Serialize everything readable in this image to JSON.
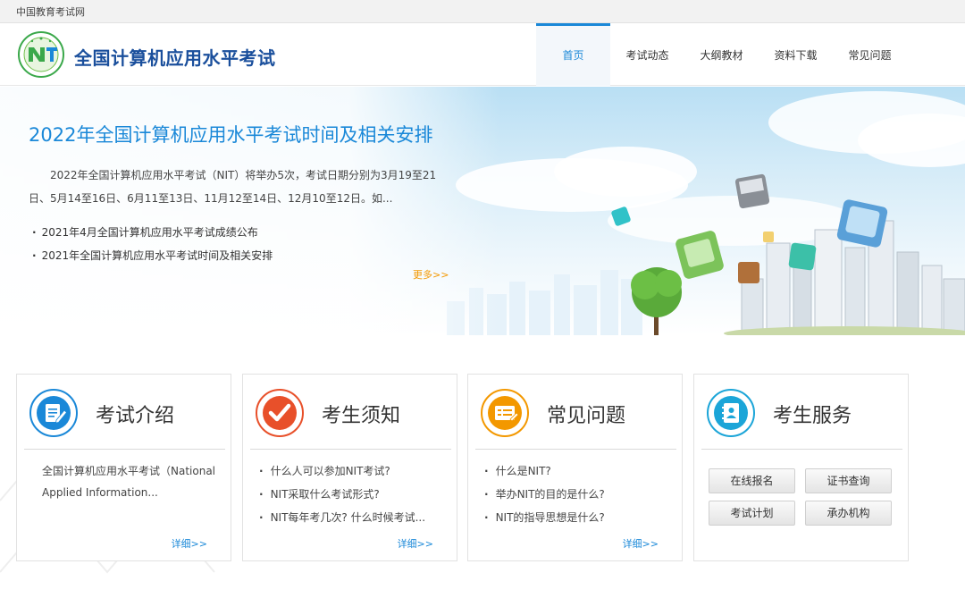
{
  "topbar": {
    "site_name": "中国教育考试网"
  },
  "header": {
    "brand": "全国计算机应用水平考试",
    "nav": [
      {
        "label": "首页",
        "active": true
      },
      {
        "label": "考试动态",
        "active": false
      },
      {
        "label": "大纲教材",
        "active": false
      },
      {
        "label": "资料下载",
        "active": false
      },
      {
        "label": "常见问题",
        "active": false
      }
    ]
  },
  "banner": {
    "title": "2022年全国计算机应用水平考试时间及相关安排",
    "description": "2022年全国计算机应用水平考试（NIT）将举办5次，考试日期分别为3月19至21日、5月14至16日、6月11至13日、11月12至14日、12月10至12日。如...",
    "news": [
      "2021年4月全国计算机应用水平考试成绩公布",
      "2021年全国计算机应用水平考试时间及相关安排"
    ],
    "more": "更多>>"
  },
  "cards": [
    {
      "title": "考试介绍",
      "icon": "document-edit-icon",
      "color": "#1a88d8",
      "intro": "全国计算机应用水平考试（National Applied Information...",
      "detail": "详细>>"
    },
    {
      "title": "考生须知",
      "icon": "checkmark-icon",
      "color": "#e8502a",
      "items": [
        "什么人可以参加NIT考试?",
        "NIT采取什么考试形式?",
        "NIT每年考几次? 什么时候考试..."
      ],
      "detail": "详细>>"
    },
    {
      "title": "常见问题",
      "icon": "list-form-icon",
      "color": "#f39800",
      "items": [
        "什么是NIT?",
        "举办NIT的目的是什么?",
        "NIT的指导思想是什么?"
      ],
      "detail": "详细>>"
    },
    {
      "title": "考生服务",
      "icon": "contacts-book-icon",
      "color": "#1ba5d8",
      "buttons": [
        "在线报名",
        "证书查询",
        "考试计划",
        "承办机构"
      ]
    }
  ]
}
